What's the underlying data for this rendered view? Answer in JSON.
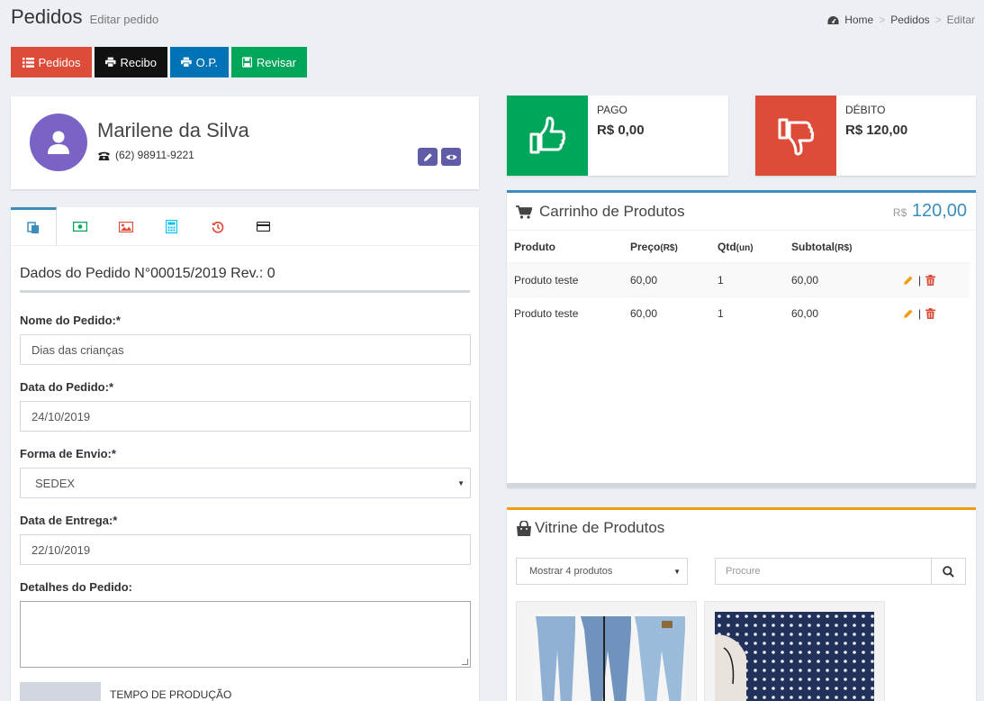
{
  "page": {
    "title": "Pedidos",
    "subtitle": "Editar pedido"
  },
  "breadcrumb": {
    "home": "Home",
    "section": "Pedidos",
    "current": "Editar"
  },
  "toolbar": {
    "pedidos": "Pedidos",
    "recibo": "Recibo",
    "op": "O.P.",
    "revisar": "Revisar"
  },
  "customer": {
    "name": "Marilene da Silva",
    "phone": "(62) 98911-9221"
  },
  "form": {
    "heading": "Dados do Pedido N°00015/2019 Rev.: 0",
    "nome_label": "Nome do Pedido:*",
    "nome_value": "Dias das crianças",
    "data_label": "Data do Pedido:*",
    "data_value": "24/10/2019",
    "envio_label": "Forma de Envio:*",
    "envio_value": "SEDEX",
    "entrega_label": "Data de Entrega:*",
    "entrega_value": "22/10/2019",
    "detalhes_label": "Detalhes do Pedido:",
    "tempo_label": "TEMPO DE PRODUÇÃO"
  },
  "pago": {
    "label": "PAGO",
    "value": "R$ 0,00",
    "color": "#00a65a"
  },
  "debito": {
    "label": "DÉBITO",
    "value": "R$ 120,00",
    "color": "#dd4b39"
  },
  "cart": {
    "title": "Carrinho de Produtos",
    "currency": "R$",
    "total": "120,00",
    "headers": {
      "produto": "Produto",
      "preco": "Preço",
      "preco_unit": "(R$)",
      "qtd": "Qtd",
      "qtd_unit": "(un)",
      "subtotal": "Subtotal",
      "subtotal_unit": "(R$)"
    },
    "rows": [
      {
        "produto": "Produto teste",
        "preco": "60,00",
        "qtd": "1",
        "subtotal": "60,00"
      },
      {
        "produto": "Produto teste",
        "preco": "60,00",
        "qtd": "1",
        "subtotal": "60,00"
      }
    ],
    "separator": "|"
  },
  "vitrine": {
    "title": "Vitrine de Produtos",
    "show_select": "Mostrar 4 produtos",
    "search_placeholder": "Procure"
  },
  "colors": {
    "primary": "#3c8dbc",
    "warning": "#f39c12",
    "purple": "#605ca8"
  }
}
